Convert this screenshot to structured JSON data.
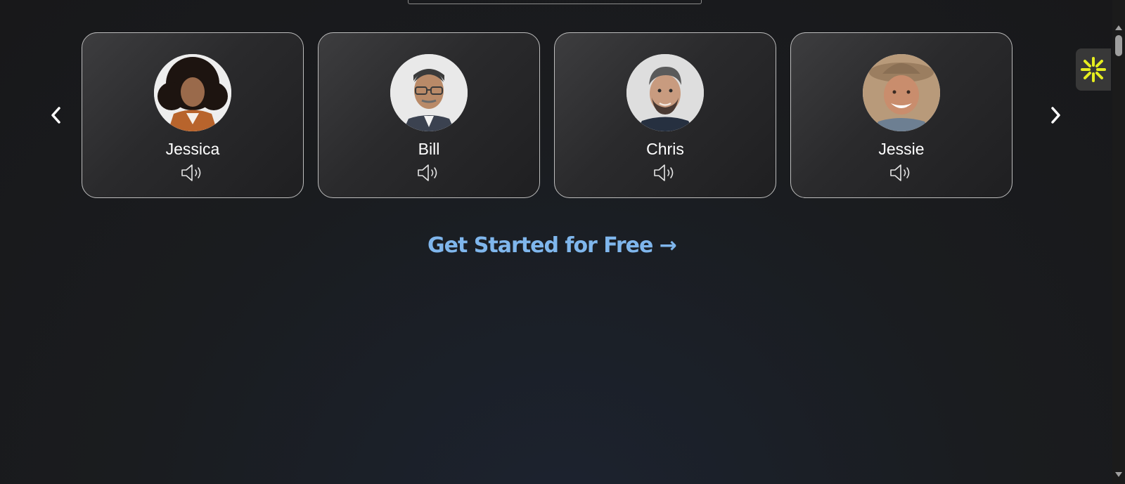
{
  "voices": [
    {
      "name": "Jessica",
      "avatar_icon": "woman-curly-hair-portrait"
    },
    {
      "name": "Bill",
      "avatar_icon": "man-glasses-portrait"
    },
    {
      "name": "Chris",
      "avatar_icon": "man-beard-portrait"
    },
    {
      "name": "Jessie",
      "avatar_icon": "man-cowboy-hat-portrait"
    }
  ],
  "carousel": {
    "prev_icon": "chevron-left-icon",
    "next_icon": "chevron-right-icon"
  },
  "cta": {
    "label": "Get Started for Free →"
  },
  "colors": {
    "accent": "#7fb6ec",
    "widget_yellow": "#e6ee1f",
    "card_border": "#bdbdbd"
  }
}
